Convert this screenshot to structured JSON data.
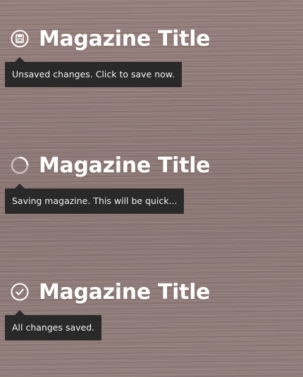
{
  "states": [
    {
      "title": "Magazine Title",
      "status_icon": "save-icon",
      "tooltip": "Unsaved changes. Click to save now."
    },
    {
      "title": "Magazine Title",
      "status_icon": "loading-spinner-icon",
      "tooltip": "Saving magazine. This will be quick..."
    },
    {
      "title": "Magazine Title",
      "status_icon": "check-icon",
      "tooltip": "All changes saved."
    }
  ],
  "colors": {
    "tooltip_background": "#2a2929",
    "tooltip_text": "#f2f2f2",
    "title_text": "#ffffff",
    "wood_background": "#8f7d7a"
  }
}
